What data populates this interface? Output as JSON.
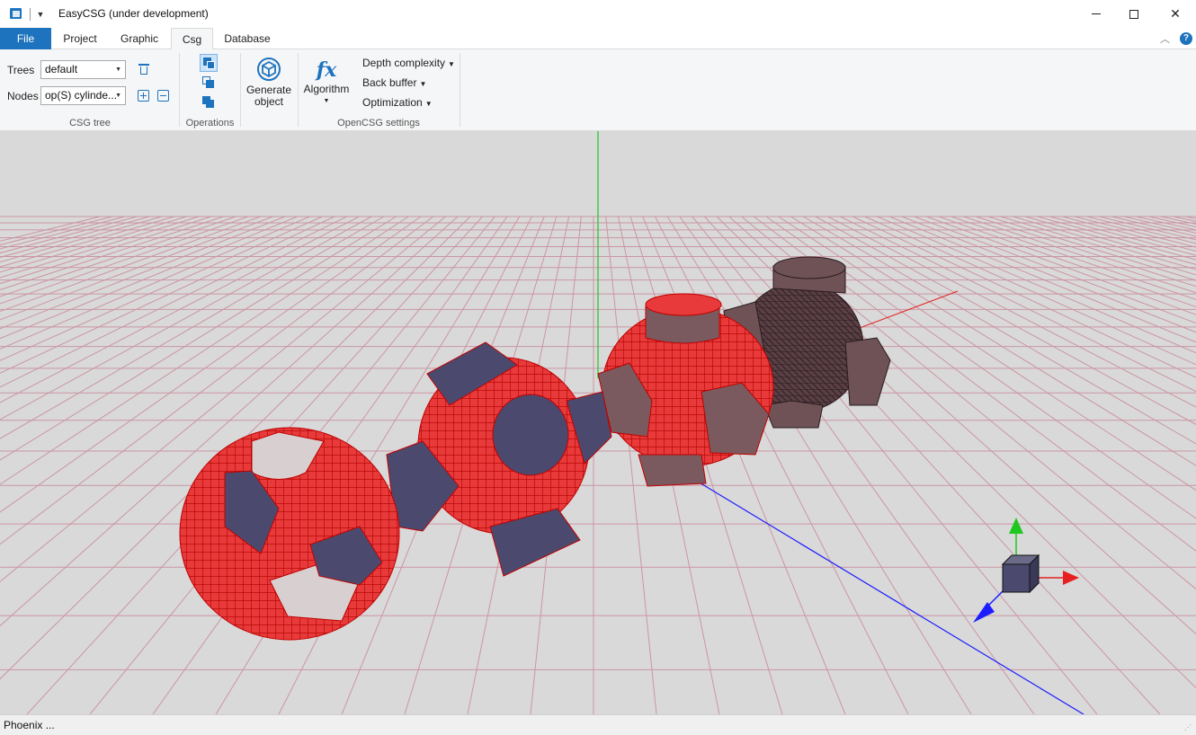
{
  "window": {
    "title": "EasyCSG (under development)"
  },
  "tabs": [
    {
      "label": "File",
      "active": false
    },
    {
      "label": "Project",
      "active": false
    },
    {
      "label": "Graphic",
      "active": false
    },
    {
      "label": "Csg",
      "active": true
    },
    {
      "label": "Database",
      "active": false
    }
  ],
  "ribbon": {
    "csg_tree": {
      "group_label": "CSG tree",
      "trees_label": "Trees",
      "trees_value": "default",
      "nodes_label": "Nodes",
      "nodes_value": "op(S) cylinde..."
    },
    "operations": {
      "group_label": "Operations"
    },
    "generate": {
      "label_line1": "Generate",
      "label_line2": "object"
    },
    "opencsg": {
      "group_label": "OpenCSG settings",
      "algorithm_label": "Algorithm",
      "depth_complexity": "Depth complexity",
      "back_buffer": "Back buffer",
      "optimization": "Optimization"
    }
  },
  "status": {
    "text": "Phoenix ..."
  },
  "colors": {
    "accent": "#1e73be",
    "viewport_bg": "#d9d9d9",
    "grid": "#c98a9a",
    "wire_red": "#e01414",
    "solid": "#4b4a6e",
    "solid_brown": "#6e5256"
  }
}
